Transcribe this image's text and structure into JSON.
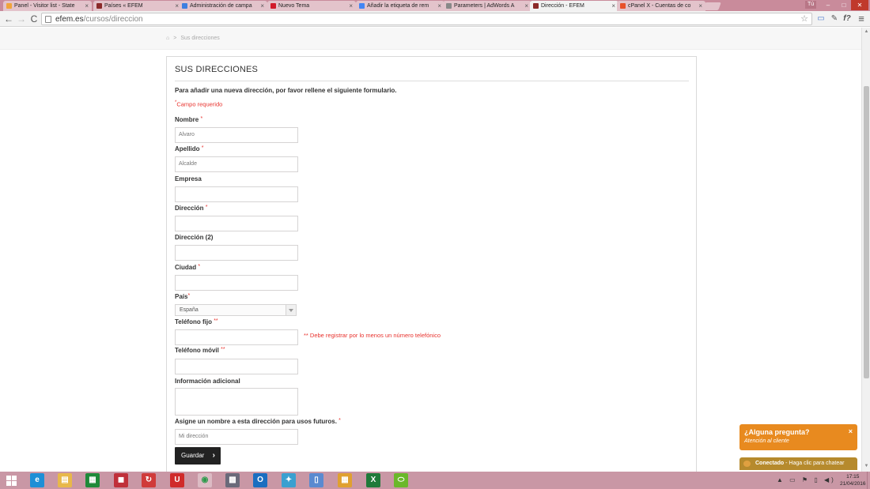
{
  "browser": {
    "tabs": [
      {
        "label": "Panel - Visitor list - State",
        "favicon_color": "#f1a43b",
        "active": false
      },
      {
        "label": "Países « EFEM",
        "favicon_color": "#8b2a2a",
        "active": false
      },
      {
        "label": "Administración de campa",
        "favicon_color": "#3d7fe0",
        "active": false
      },
      {
        "label": "Nuevo Tema",
        "favicon_color": "#d11a2a",
        "active": false
      },
      {
        "label": "Añadir la etiqueta de rem",
        "favicon_color": "#4285f4",
        "active": false
      },
      {
        "label": "Parameters | AdWords A",
        "favicon_color": "#888888",
        "active": false
      },
      {
        "label": "Dirección - EFEM",
        "favicon_color": "#8b2a2a",
        "active": true
      },
      {
        "label": "cPanel X - Cuentas de co",
        "favicon_color": "#e8502a",
        "active": false
      }
    ],
    "tab_close": "×",
    "user_chip": "Tú",
    "window_controls": {
      "minimize": "–",
      "maximize": "□",
      "close": "✕"
    },
    "nav": {
      "back": "←",
      "forward": "→",
      "reload": "C"
    },
    "url_host": "efem.es",
    "url_path": "/cursos/direccion",
    "star": "☆",
    "extensions": [
      "▭",
      "✎",
      "f?",
      "≡"
    ]
  },
  "page": {
    "breadcrumb": {
      "home_icon": "home-icon",
      "home": "⌂",
      "separator": ">",
      "current": "Sus direcciones"
    },
    "title": "SUS DIRECCIONES",
    "intro": "Para añadir una nueva dirección, por favor rellene el siguiente formulario.",
    "required_note": {
      "marker": "*",
      "text": "Campo requerido"
    },
    "fields": {
      "nombre": {
        "label": "Nombre",
        "req": "*",
        "value": "Alvaro"
      },
      "apellido": {
        "label": "Apellido",
        "req": "*",
        "value": "Alcalde"
      },
      "empresa": {
        "label": "Empresa",
        "req": "",
        "value": ""
      },
      "direccion": {
        "label": "Dirección",
        "req": "*",
        "value": ""
      },
      "direccion2": {
        "label": "Dirección (2)",
        "req": "",
        "value": ""
      },
      "ciudad": {
        "label": "Ciudad",
        "req": "*",
        "value": ""
      },
      "pais": {
        "label": "País",
        "req": "*",
        "value": "España"
      },
      "telefono_fijo": {
        "label": "Teléfono fijo",
        "req": "**",
        "value": ""
      },
      "telefono_movil": {
        "label": "Teléfono móvil",
        "req": "**",
        "value": ""
      },
      "info_adicional": {
        "label": "Información adicional",
        "req": "",
        "value": ""
      },
      "alias": {
        "label": "Asigne un nombre a esta dirección para usos futuros.",
        "req": "*",
        "value": "Mi dirección"
      }
    },
    "phone_hint": "** Debe registrar por lo menos un número telefónico",
    "save_button": "Guardar",
    "save_chevron": "›"
  },
  "chat": {
    "title": "¿Alguna pregunta?",
    "subtitle": "Atención al cliente",
    "close": "×",
    "status_bold": "Conectado",
    "status_text": " - Haga clic para chatear"
  },
  "taskbar": {
    "apps": [
      {
        "name": "internet-explorer-icon",
        "glyph": "e",
        "color": "#1e8fd6"
      },
      {
        "name": "file-explorer-icon",
        "glyph": "▤",
        "color": "#e8b84a"
      },
      {
        "name": "store-icon",
        "glyph": "▦",
        "color": "#1f8a3a"
      },
      {
        "name": "app-red-black-icon",
        "glyph": "◼",
        "color": "#c0303a"
      },
      {
        "name": "sync-icon",
        "glyph": "↻",
        "color": "#d03a3a"
      },
      {
        "name": "security-icon",
        "glyph": "U",
        "color": "#d02a2a"
      },
      {
        "name": "chrome-icon",
        "glyph": "◉",
        "color": "#2a9a4a"
      },
      {
        "name": "network-app-icon",
        "glyph": "▩",
        "color": "#6a6a7a"
      },
      {
        "name": "outlook-icon",
        "glyph": "O",
        "color": "#1a6ec0"
      },
      {
        "name": "bird-app-icon",
        "glyph": "✦",
        "color": "#3aa0d0"
      },
      {
        "name": "notepad-icon",
        "glyph": "▯",
        "color": "#5a8ad0"
      },
      {
        "name": "grid-app-icon",
        "glyph": "▦",
        "color": "#e0a030"
      },
      {
        "name": "excel-icon",
        "glyph": "X",
        "color": "#1f7a3a"
      },
      {
        "name": "green-app-icon",
        "glyph": "⬭",
        "color": "#6ab82a"
      }
    ],
    "tray_icons": "▲ ▭ ⚑ ▯ ◀)",
    "time": "17:15",
    "date": "21/04/2016"
  }
}
